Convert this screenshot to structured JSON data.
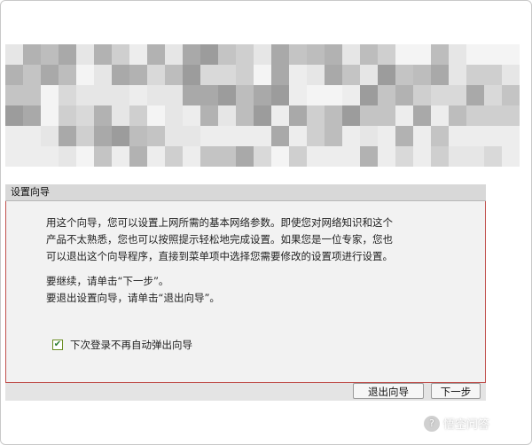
{
  "wizard": {
    "title": "设置向导",
    "intro_lines": [
      "用这个向导，您可以设置上网所需的基本网络参数。即使您对网络知识和这个",
      "产品不太熟悉，您也可以按照提示轻松地完成设置。如果您是一位专家，您也",
      "可以退出这个向导程序，直接到菜单项中选择您需要修改的设置项进行设置。"
    ],
    "continue_text": "要继续，请单击“下一步”。",
    "exit_text": "要退出设置向导，请单击“退出向导”。",
    "checkbox": {
      "label": "下次登录不再自动弹出向导",
      "checked": true
    },
    "buttons": {
      "exit": "退出向导",
      "next": "下一步"
    }
  },
  "watermark": {
    "text": "悟空问答",
    "icon": "question-bubble-icon"
  },
  "colors": {
    "body_border": "#c0504d",
    "title_bar": "#d8d8d8",
    "panel": "#f2f2f2"
  }
}
